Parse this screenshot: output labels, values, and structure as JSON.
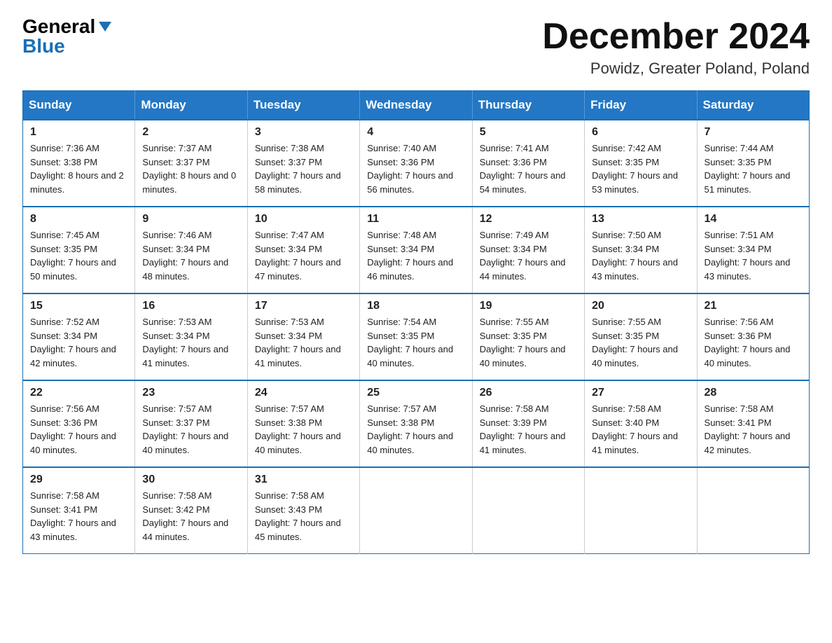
{
  "header": {
    "logo": {
      "general_text": "General",
      "blue_text": "Blue"
    },
    "title": "December 2024",
    "location": "Powidz, Greater Poland, Poland"
  },
  "calendar": {
    "days_of_week": [
      "Sunday",
      "Monday",
      "Tuesday",
      "Wednesday",
      "Thursday",
      "Friday",
      "Saturday"
    ],
    "weeks": [
      [
        {
          "day": "1",
          "sunrise": "7:36 AM",
          "sunset": "3:38 PM",
          "daylight": "8 hours and 2 minutes."
        },
        {
          "day": "2",
          "sunrise": "7:37 AM",
          "sunset": "3:37 PM",
          "daylight": "8 hours and 0 minutes."
        },
        {
          "day": "3",
          "sunrise": "7:38 AM",
          "sunset": "3:37 PM",
          "daylight": "7 hours and 58 minutes."
        },
        {
          "day": "4",
          "sunrise": "7:40 AM",
          "sunset": "3:36 PM",
          "daylight": "7 hours and 56 minutes."
        },
        {
          "day": "5",
          "sunrise": "7:41 AM",
          "sunset": "3:36 PM",
          "daylight": "7 hours and 54 minutes."
        },
        {
          "day": "6",
          "sunrise": "7:42 AM",
          "sunset": "3:35 PM",
          "daylight": "7 hours and 53 minutes."
        },
        {
          "day": "7",
          "sunrise": "7:44 AM",
          "sunset": "3:35 PM",
          "daylight": "7 hours and 51 minutes."
        }
      ],
      [
        {
          "day": "8",
          "sunrise": "7:45 AM",
          "sunset": "3:35 PM",
          "daylight": "7 hours and 50 minutes."
        },
        {
          "day": "9",
          "sunrise": "7:46 AM",
          "sunset": "3:34 PM",
          "daylight": "7 hours and 48 minutes."
        },
        {
          "day": "10",
          "sunrise": "7:47 AM",
          "sunset": "3:34 PM",
          "daylight": "7 hours and 47 minutes."
        },
        {
          "day": "11",
          "sunrise": "7:48 AM",
          "sunset": "3:34 PM",
          "daylight": "7 hours and 46 minutes."
        },
        {
          "day": "12",
          "sunrise": "7:49 AM",
          "sunset": "3:34 PM",
          "daylight": "7 hours and 44 minutes."
        },
        {
          "day": "13",
          "sunrise": "7:50 AM",
          "sunset": "3:34 PM",
          "daylight": "7 hours and 43 minutes."
        },
        {
          "day": "14",
          "sunrise": "7:51 AM",
          "sunset": "3:34 PM",
          "daylight": "7 hours and 43 minutes."
        }
      ],
      [
        {
          "day": "15",
          "sunrise": "7:52 AM",
          "sunset": "3:34 PM",
          "daylight": "7 hours and 42 minutes."
        },
        {
          "day": "16",
          "sunrise": "7:53 AM",
          "sunset": "3:34 PM",
          "daylight": "7 hours and 41 minutes."
        },
        {
          "day": "17",
          "sunrise": "7:53 AM",
          "sunset": "3:34 PM",
          "daylight": "7 hours and 41 minutes."
        },
        {
          "day": "18",
          "sunrise": "7:54 AM",
          "sunset": "3:35 PM",
          "daylight": "7 hours and 40 minutes."
        },
        {
          "day": "19",
          "sunrise": "7:55 AM",
          "sunset": "3:35 PM",
          "daylight": "7 hours and 40 minutes."
        },
        {
          "day": "20",
          "sunrise": "7:55 AM",
          "sunset": "3:35 PM",
          "daylight": "7 hours and 40 minutes."
        },
        {
          "day": "21",
          "sunrise": "7:56 AM",
          "sunset": "3:36 PM",
          "daylight": "7 hours and 40 minutes."
        }
      ],
      [
        {
          "day": "22",
          "sunrise": "7:56 AM",
          "sunset": "3:36 PM",
          "daylight": "7 hours and 40 minutes."
        },
        {
          "day": "23",
          "sunrise": "7:57 AM",
          "sunset": "3:37 PM",
          "daylight": "7 hours and 40 minutes."
        },
        {
          "day": "24",
          "sunrise": "7:57 AM",
          "sunset": "3:38 PM",
          "daylight": "7 hours and 40 minutes."
        },
        {
          "day": "25",
          "sunrise": "7:57 AM",
          "sunset": "3:38 PM",
          "daylight": "7 hours and 40 minutes."
        },
        {
          "day": "26",
          "sunrise": "7:58 AM",
          "sunset": "3:39 PM",
          "daylight": "7 hours and 41 minutes."
        },
        {
          "day": "27",
          "sunrise": "7:58 AM",
          "sunset": "3:40 PM",
          "daylight": "7 hours and 41 minutes."
        },
        {
          "day": "28",
          "sunrise": "7:58 AM",
          "sunset": "3:41 PM",
          "daylight": "7 hours and 42 minutes."
        }
      ],
      [
        {
          "day": "29",
          "sunrise": "7:58 AM",
          "sunset": "3:41 PM",
          "daylight": "7 hours and 43 minutes."
        },
        {
          "day": "30",
          "sunrise": "7:58 AM",
          "sunset": "3:42 PM",
          "daylight": "7 hours and 44 minutes."
        },
        {
          "day": "31",
          "sunrise": "7:58 AM",
          "sunset": "3:43 PM",
          "daylight": "7 hours and 45 minutes."
        },
        null,
        null,
        null,
        null
      ]
    ]
  }
}
